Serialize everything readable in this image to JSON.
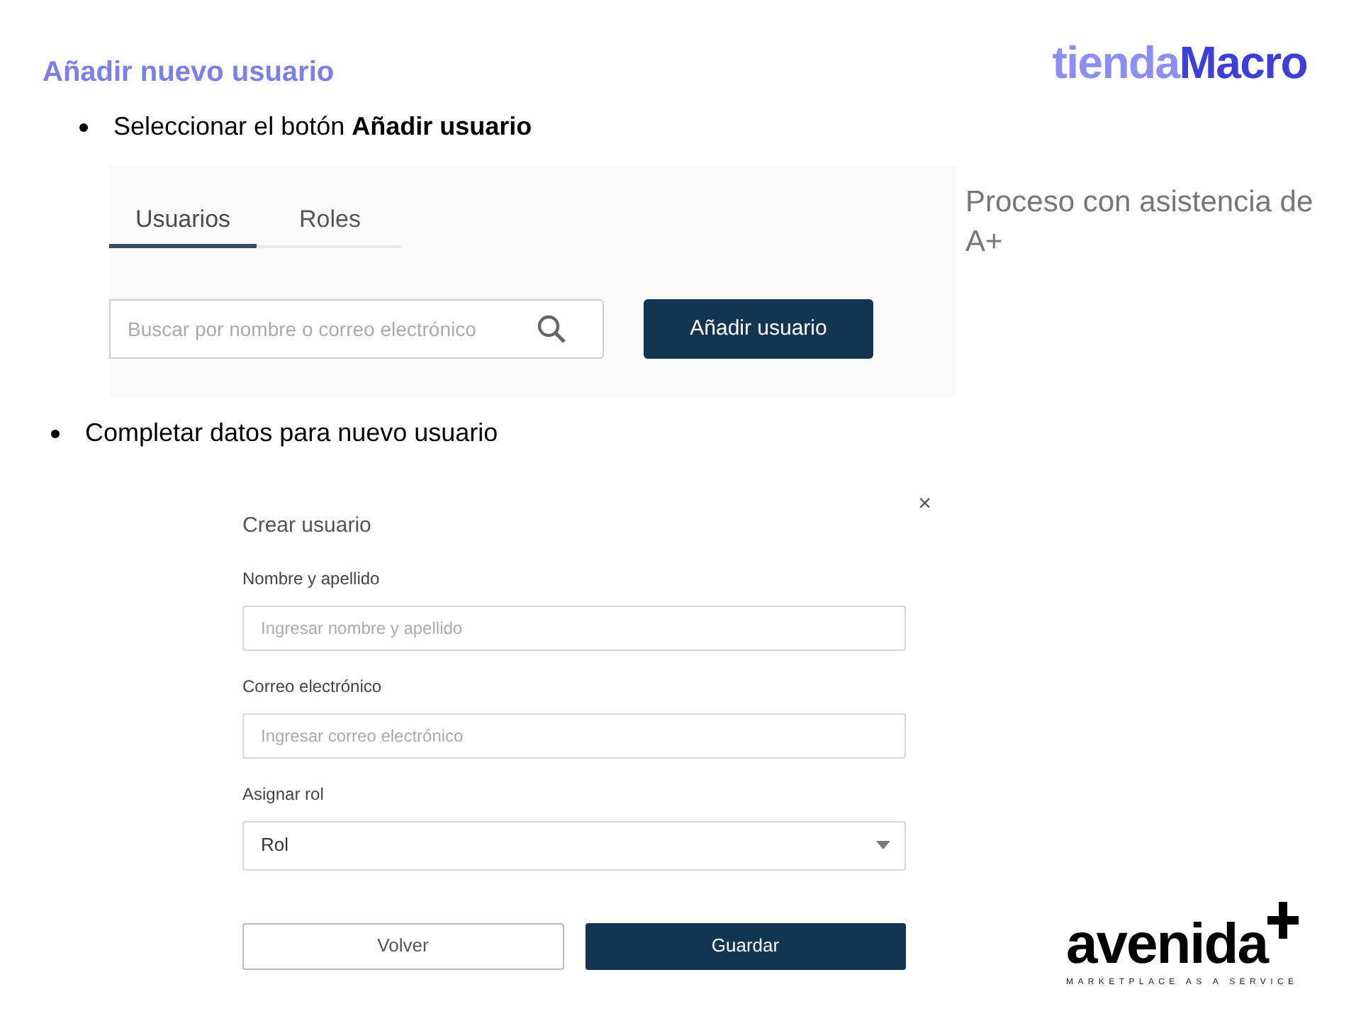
{
  "slide_title": "Añadir nuevo usuario",
  "brand_logo": {
    "part_1": "tienda",
    "part_2": "Macro"
  },
  "bullets": [
    "Seleccionar el botón **Añadir usuario**",
    "Completar datos para nuevo usuario"
  ],
  "users_screen": {
    "tabs": [
      {
        "label": "Usuarios",
        "selected": true
      },
      {
        "label": "Roles",
        "selected": false
      }
    ],
    "search": {
      "placeholder": "Buscar por nombre o correo electrónico"
    },
    "add_button": "Añadir usuario"
  },
  "note": "Proceso con asistencia de A+",
  "dialog": {
    "title": "Crear usuario",
    "close": "×",
    "fields": [
      {
        "kind": "text",
        "label": "Nombre y apellido",
        "placeholder": "Ingresar nombre y apellido"
      },
      {
        "kind": "text",
        "label": "Correo electrónico",
        "placeholder": "Ingresar correo electrónico"
      },
      {
        "kind": "select",
        "label": "Asignar rol",
        "value": "Rol"
      }
    ],
    "buttons": [
      {
        "label": "Volver",
        "kind": "secondary"
      },
      {
        "label": "Guardar",
        "kind": "primary"
      }
    ]
  },
  "footer_logo": {
    "name": "avenida",
    "tagline": "MARKETPLACE AS A SERVICE"
  }
}
